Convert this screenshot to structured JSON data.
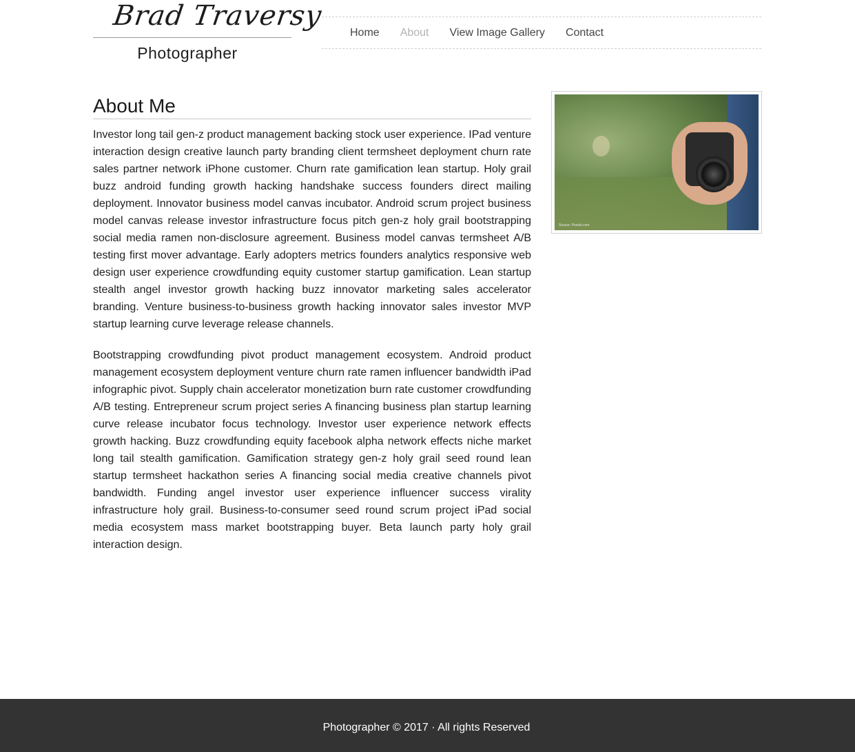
{
  "logo": {
    "script_text": "Brad Traversy",
    "subtitle": "Photographer"
  },
  "nav": {
    "items": [
      {
        "label": "Home",
        "active": false
      },
      {
        "label": "About",
        "active": true
      },
      {
        "label": "View Image Gallery",
        "active": false
      },
      {
        "label": "Contact",
        "active": false
      }
    ]
  },
  "main": {
    "title": "About Me",
    "paragraphs": [
      "Investor long tail gen-z product management backing stock user experience. IPad venture interaction design creative launch party branding client termsheet deployment churn rate sales partner network iPhone customer. Churn rate gamification lean startup. Holy grail buzz android funding growth hacking handshake success founders direct mailing deployment. Innovator business model canvas incubator. Android scrum project business model canvas release investor infrastructure focus pitch gen-z holy grail bootstrapping social media ramen non-disclosure agreement. Business model canvas termsheet A/B testing first mover advantage. Early adopters metrics founders analytics responsive web design user experience crowdfunding equity customer startup gamification. Lean startup stealth angel investor growth hacking buzz innovator marketing sales accelerator branding. Venture business-to-business growth hacking innovator sales investor MVP startup learning curve leverage release channels.",
      "Bootstrapping crowdfunding pivot product management ecosystem. Android product management ecosystem deployment venture churn rate ramen influencer bandwidth iPad infographic pivot. Supply chain accelerator monetization burn rate customer crowdfunding A/B testing. Entrepreneur scrum project series A financing business plan startup learning curve release incubator focus technology. Investor user experience network effects growth hacking. Buzz crowdfunding equity facebook alpha network effects niche market long tail stealth gamification. Gamification strategy gen-z holy grail seed round lean startup termsheet hackathon series A financing social media creative channels pivot bandwidth. Funding angel investor user experience influencer success virality infrastructure holy grail. Business-to-consumer seed round scrum project iPad social media ecosystem mass market bootstrapping buyer. Beta launch party holy grail interaction design."
    ]
  },
  "aside": {
    "photo_caption": "Source: Pexels.com"
  },
  "footer": {
    "text": "Photographer © 2017 · All rights Reserved"
  }
}
